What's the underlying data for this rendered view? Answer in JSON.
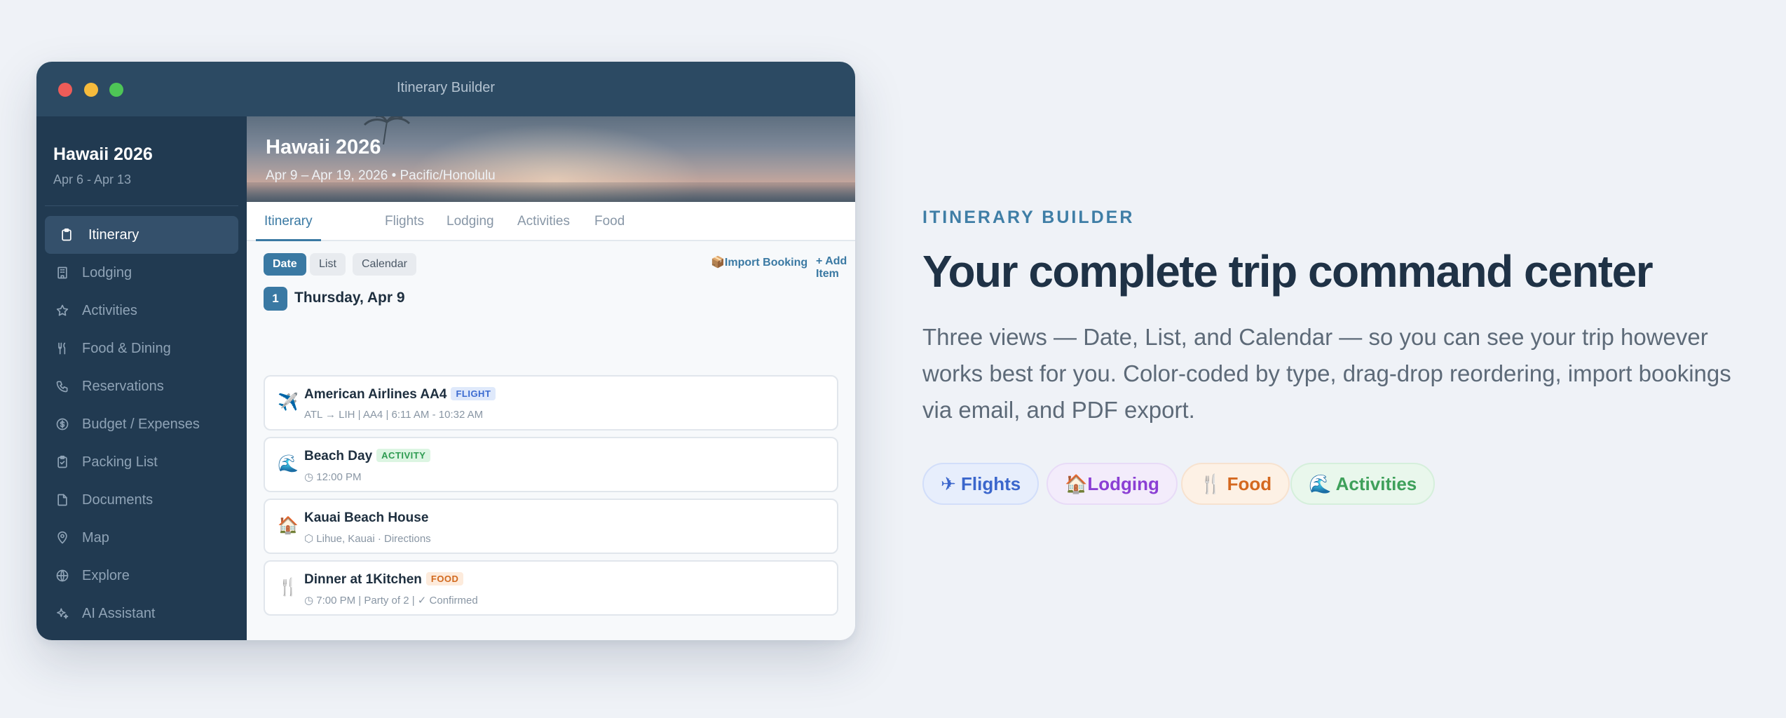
{
  "window": {
    "title": "Itinerary Builder"
  },
  "sidebar": {
    "trip_name": "Hawaii 2026",
    "trip_dates": "Apr 6 - Apr 13",
    "items": [
      {
        "label": "Itinerary",
        "icon": "clipboard-icon"
      },
      {
        "label": "Lodging",
        "icon": "building-icon"
      },
      {
        "label": "Activities",
        "icon": "star-icon"
      },
      {
        "label": "Food & Dining",
        "icon": "utensils-icon"
      },
      {
        "label": "Reservations",
        "icon": "phone-icon"
      },
      {
        "label": "Budget / Expenses",
        "icon": "dollar-icon"
      },
      {
        "label": "Packing List",
        "icon": "checklist-icon"
      },
      {
        "label": "Documents",
        "icon": "document-icon"
      },
      {
        "label": "Map",
        "icon": "map-pin-icon"
      },
      {
        "label": "Explore",
        "icon": "globe-icon"
      },
      {
        "label": "AI Assistant",
        "icon": "sparkle-icon"
      }
    ],
    "active_index": 0
  },
  "hero": {
    "title": "Hawaii 2026",
    "subtitle": "Apr 9 – Apr 19, 2026 • Pacific/Honolulu"
  },
  "tabs": [
    "Itinerary",
    "Flights",
    "Lodging",
    "Activities",
    "Food"
  ],
  "active_tab": "Itinerary",
  "views": [
    "Date",
    "List",
    "Calendar"
  ],
  "active_view": "Date",
  "actions": {
    "import_icon": "📦",
    "import_label": "Import Booking",
    "add_label": "+ Add Item"
  },
  "day": {
    "number": "1",
    "title": "Thursday, Apr 9"
  },
  "items": [
    {
      "icon": "✈️",
      "title": "American Airlines AA4",
      "badge": "FLIGHT",
      "sub": "ATL → LIH | AA4 | 6:11 AM - 10:32 AM"
    },
    {
      "icon": "🌊",
      "title": "Beach Day",
      "badge": "ACTIVITY",
      "sub": "◷ 12:00 PM"
    },
    {
      "icon": "🏠",
      "title": "Kauai Beach House",
      "badge": "",
      "sub": "⬡ Lihue, Kauai · Directions"
    },
    {
      "icon": "🍴",
      "title": "Dinner at 1Kitchen",
      "badge": "FOOD",
      "sub": "◷ 7:00 PM | Party of 2 | ✓ Confirmed"
    }
  ],
  "marketing": {
    "eyebrow": "ITINERARY BUILDER",
    "headline": "Your complete trip command center",
    "body": "Three views — Date, List, and Calendar — so you can see your trip however works best for you. Color-coded by type, drag-drop reordering, import bookings via email, and PDF export.",
    "pills": [
      {
        "icon": "✈",
        "label": "Flights"
      },
      {
        "icon": "🏠",
        "label": "Lodging"
      },
      {
        "icon": "🍴",
        "label": "Food"
      },
      {
        "icon": "🌊",
        "label": "Activities"
      }
    ]
  },
  "colors": {
    "accent": "#3a79a3",
    "sidebar": "#213a51",
    "titlebar": "#2c4a63",
    "flight": "#3b66cc",
    "lodging": "#8b3fd4",
    "food": "#d4681f",
    "activity": "#3ea05a"
  }
}
